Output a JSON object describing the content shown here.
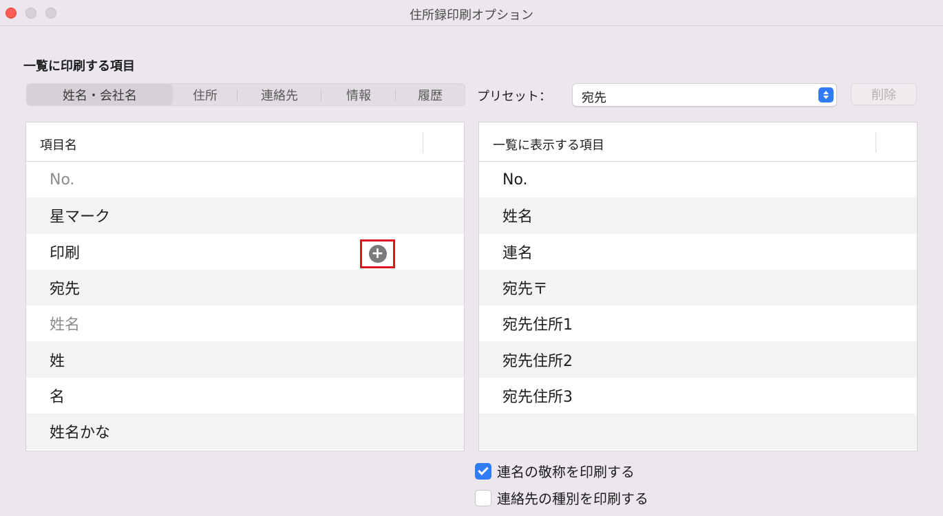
{
  "window": {
    "title": "住所録印刷オプション"
  },
  "section": {
    "heading": "一覧に印刷する項目"
  },
  "tabs": [
    {
      "label": "姓名・会社名",
      "active": true
    },
    {
      "label": "住所",
      "active": false
    },
    {
      "label": "連絡先",
      "active": false
    },
    {
      "label": "情報",
      "active": false
    },
    {
      "label": "履歴",
      "active": false
    }
  ],
  "preset": {
    "label": "プリセット：",
    "value": "宛先"
  },
  "delete_button": {
    "label": "削除"
  },
  "left_list": {
    "header": "項目名",
    "rows": [
      {
        "label": "No.",
        "dim": true
      },
      {
        "label": "星マーク",
        "dim": false
      },
      {
        "label": "印刷",
        "dim": false
      },
      {
        "label": "宛先",
        "dim": false
      },
      {
        "label": "姓名",
        "dim": true
      },
      {
        "label": "姓",
        "dim": false
      },
      {
        "label": "名",
        "dim": false
      },
      {
        "label": "姓名かな",
        "dim": false
      }
    ],
    "add_icon": "plus-circle-icon"
  },
  "right_list": {
    "header": "一覧に表示する項目",
    "rows": [
      {
        "label": "No."
      },
      {
        "label": "姓名"
      },
      {
        "label": "連名"
      },
      {
        "label": "宛先〒"
      },
      {
        "label": "宛先住所1"
      },
      {
        "label": "宛先住所2"
      },
      {
        "label": "宛先住所3"
      },
      {
        "label": ""
      }
    ]
  },
  "options": {
    "print_joint_honorific": {
      "label": "連名の敬称を印刷する",
      "checked": true
    },
    "print_contact_type": {
      "label": "連絡先の種別を印刷する",
      "checked": false
    }
  },
  "colors": {
    "accent": "#2f7cf6",
    "close": "#ff5f57",
    "highlight": "#e0141e"
  }
}
